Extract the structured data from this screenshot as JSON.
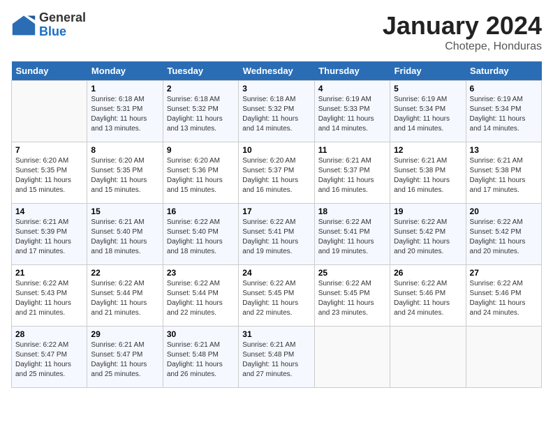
{
  "header": {
    "logo_general": "General",
    "logo_blue": "Blue",
    "month": "January 2024",
    "location": "Chotepe, Honduras"
  },
  "weekdays": [
    "Sunday",
    "Monday",
    "Tuesday",
    "Wednesday",
    "Thursday",
    "Friday",
    "Saturday"
  ],
  "weeks": [
    [
      {
        "day": "",
        "sunrise": "",
        "sunset": "",
        "daylight": ""
      },
      {
        "day": "1",
        "sunrise": "6:18 AM",
        "sunset": "5:31 PM",
        "daylight": "11 hours and 13 minutes."
      },
      {
        "day": "2",
        "sunrise": "6:18 AM",
        "sunset": "5:32 PM",
        "daylight": "11 hours and 13 minutes."
      },
      {
        "day": "3",
        "sunrise": "6:18 AM",
        "sunset": "5:32 PM",
        "daylight": "11 hours and 14 minutes."
      },
      {
        "day": "4",
        "sunrise": "6:19 AM",
        "sunset": "5:33 PM",
        "daylight": "11 hours and 14 minutes."
      },
      {
        "day": "5",
        "sunrise": "6:19 AM",
        "sunset": "5:34 PM",
        "daylight": "11 hours and 14 minutes."
      },
      {
        "day": "6",
        "sunrise": "6:19 AM",
        "sunset": "5:34 PM",
        "daylight": "11 hours and 14 minutes."
      }
    ],
    [
      {
        "day": "7",
        "sunrise": "6:20 AM",
        "sunset": "5:35 PM",
        "daylight": "11 hours and 15 minutes."
      },
      {
        "day": "8",
        "sunrise": "6:20 AM",
        "sunset": "5:35 PM",
        "daylight": "11 hours and 15 minutes."
      },
      {
        "day": "9",
        "sunrise": "6:20 AM",
        "sunset": "5:36 PM",
        "daylight": "11 hours and 15 minutes."
      },
      {
        "day": "10",
        "sunrise": "6:20 AM",
        "sunset": "5:37 PM",
        "daylight": "11 hours and 16 minutes."
      },
      {
        "day": "11",
        "sunrise": "6:21 AM",
        "sunset": "5:37 PM",
        "daylight": "11 hours and 16 minutes."
      },
      {
        "day": "12",
        "sunrise": "6:21 AM",
        "sunset": "5:38 PM",
        "daylight": "11 hours and 16 minutes."
      },
      {
        "day": "13",
        "sunrise": "6:21 AM",
        "sunset": "5:38 PM",
        "daylight": "11 hours and 17 minutes."
      }
    ],
    [
      {
        "day": "14",
        "sunrise": "6:21 AM",
        "sunset": "5:39 PM",
        "daylight": "11 hours and 17 minutes."
      },
      {
        "day": "15",
        "sunrise": "6:21 AM",
        "sunset": "5:40 PM",
        "daylight": "11 hours and 18 minutes."
      },
      {
        "day": "16",
        "sunrise": "6:22 AM",
        "sunset": "5:40 PM",
        "daylight": "11 hours and 18 minutes."
      },
      {
        "day": "17",
        "sunrise": "6:22 AM",
        "sunset": "5:41 PM",
        "daylight": "11 hours and 19 minutes."
      },
      {
        "day": "18",
        "sunrise": "6:22 AM",
        "sunset": "5:41 PM",
        "daylight": "11 hours and 19 minutes."
      },
      {
        "day": "19",
        "sunrise": "6:22 AM",
        "sunset": "5:42 PM",
        "daylight": "11 hours and 20 minutes."
      },
      {
        "day": "20",
        "sunrise": "6:22 AM",
        "sunset": "5:42 PM",
        "daylight": "11 hours and 20 minutes."
      }
    ],
    [
      {
        "day": "21",
        "sunrise": "6:22 AM",
        "sunset": "5:43 PM",
        "daylight": "11 hours and 21 minutes."
      },
      {
        "day": "22",
        "sunrise": "6:22 AM",
        "sunset": "5:44 PM",
        "daylight": "11 hours and 21 minutes."
      },
      {
        "day": "23",
        "sunrise": "6:22 AM",
        "sunset": "5:44 PM",
        "daylight": "11 hours and 22 minutes."
      },
      {
        "day": "24",
        "sunrise": "6:22 AM",
        "sunset": "5:45 PM",
        "daylight": "11 hours and 22 minutes."
      },
      {
        "day": "25",
        "sunrise": "6:22 AM",
        "sunset": "5:45 PM",
        "daylight": "11 hours and 23 minutes."
      },
      {
        "day": "26",
        "sunrise": "6:22 AM",
        "sunset": "5:46 PM",
        "daylight": "11 hours and 24 minutes."
      },
      {
        "day": "27",
        "sunrise": "6:22 AM",
        "sunset": "5:46 PM",
        "daylight": "11 hours and 24 minutes."
      }
    ],
    [
      {
        "day": "28",
        "sunrise": "6:22 AM",
        "sunset": "5:47 PM",
        "daylight": "11 hours and 25 minutes."
      },
      {
        "day": "29",
        "sunrise": "6:21 AM",
        "sunset": "5:47 PM",
        "daylight": "11 hours and 25 minutes."
      },
      {
        "day": "30",
        "sunrise": "6:21 AM",
        "sunset": "5:48 PM",
        "daylight": "11 hours and 26 minutes."
      },
      {
        "day": "31",
        "sunrise": "6:21 AM",
        "sunset": "5:48 PM",
        "daylight": "11 hours and 27 minutes."
      },
      {
        "day": "",
        "sunrise": "",
        "sunset": "",
        "daylight": ""
      },
      {
        "day": "",
        "sunrise": "",
        "sunset": "",
        "daylight": ""
      },
      {
        "day": "",
        "sunrise": "",
        "sunset": "",
        "daylight": ""
      }
    ]
  ],
  "labels": {
    "sunrise_prefix": "Sunrise: ",
    "sunset_prefix": "Sunset: ",
    "daylight_prefix": "Daylight: "
  }
}
